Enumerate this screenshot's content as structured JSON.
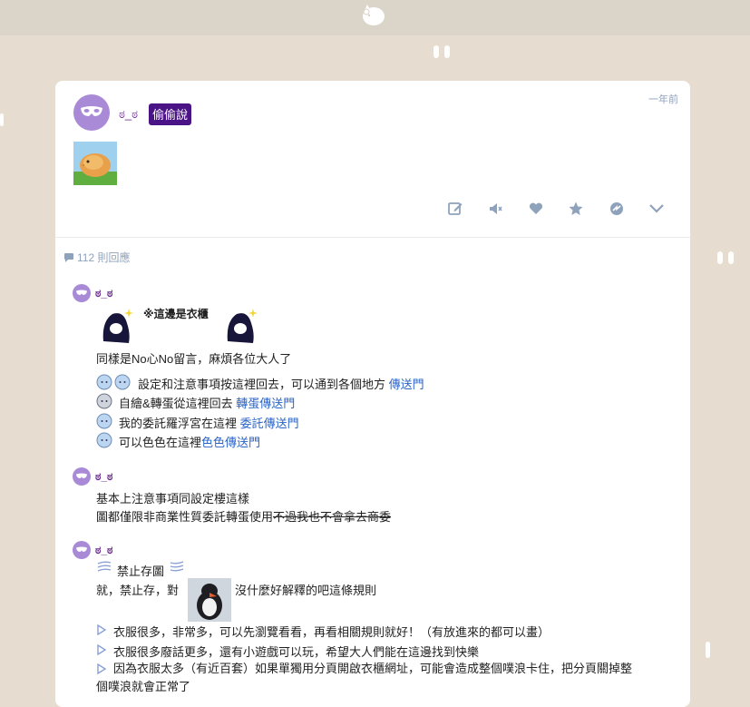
{
  "header": {
    "logo_icon": "cat-face-logo-icon",
    "bg": "#dbd4c8"
  },
  "post": {
    "author": "ಠ_ಠ",
    "badge": "偷偷說",
    "time": "一年前",
    "thumbnail_icon": "fluffy-chick-thumbnail",
    "actions": [
      "edit-icon",
      "mute-icon",
      "like-icon",
      "favorite-icon",
      "share-icon",
      "expand-icon"
    ]
  },
  "replies_count": "112 則回應",
  "replies": [
    {
      "author": "ಠ_ಠ",
      "title_text": "※這邊是衣櫃",
      "intro": "同樣是No心No留言，麻煩各位大人了",
      "items": [
        {
          "text": "設定和注意事項按這裡回去，可以通到各個地方",
          "link": "傳送門"
        },
        {
          "text": "自繪&轉蛋從這裡回去",
          "link": "轉蛋傳送門"
        },
        {
          "text": "我的委託羅浮宮在這裡",
          "link": "委託傳送門"
        },
        {
          "text": "可以色色在這裡",
          "link": "色色傳送門"
        }
      ]
    },
    {
      "author": "ಠ_ಠ",
      "line1": "基本上注意事項同設定樓這樣",
      "line2_plain": "圖都僅限非商業性質委託轉蛋使用",
      "line2_strike": "不過我也不會拿去商委"
    },
    {
      "author": "ಠ_ಠ",
      "title_text": "禁止存圖",
      "line1_before": "就，禁止存，對",
      "line1_after": "沒什麼好解釋的吧這條規則",
      "bullets": [
        "衣服很多，非常多，可以先瀏覽看看，再看相關規則就好！（有放進來的都可以畫）",
        "衣服很多廢話更多，還有小遊戲可以玩，希望大人們能在這邊找到快樂",
        "因為衣服太多（有近百套）如果單獨用分頁開啟衣櫃網址，可能會造成整個噗浪卡住，把分頁關掉整",
        "個噗浪就會正常了"
      ]
    }
  ],
  "colors": {
    "page_bg": "#e6dccf",
    "name": "#6b2c8f",
    "badge_bg": "#4a1386",
    "link": "#2a64c7",
    "muted": "#8fa2bb",
    "avatar": "#a98ad6"
  }
}
